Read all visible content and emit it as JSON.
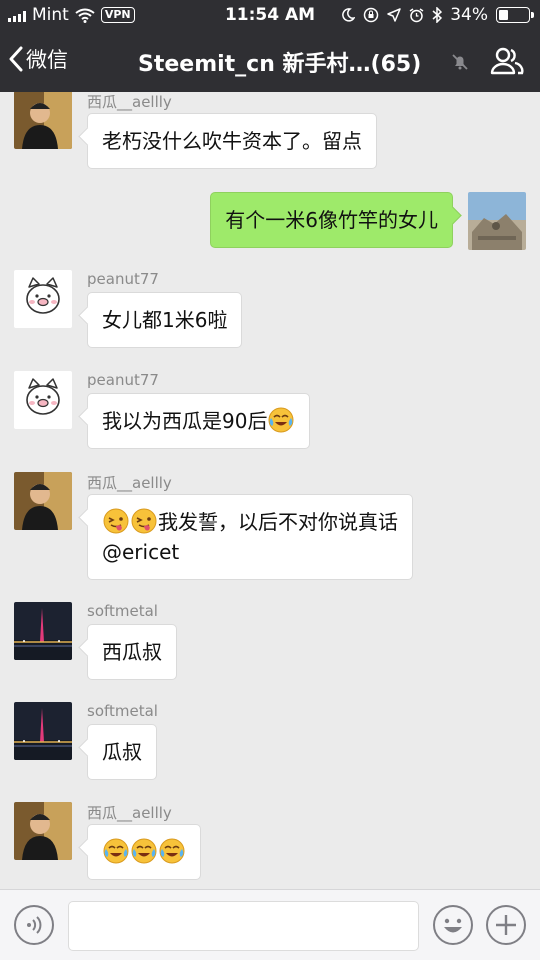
{
  "status_bar": {
    "carrier": "Mint",
    "vpn": "VPN",
    "time": "11:54 AM",
    "battery_percent": "34%",
    "battery_level": 0.34
  },
  "nav": {
    "back_label": "微信",
    "title": "Steemit_cn 新手村…(65)",
    "muted_icon": "bell-off-icon",
    "members_icon": "group-members-icon"
  },
  "messages": [
    {
      "direction": "in",
      "sender": "西瓜__aellly",
      "text": "老朽没什么吹牛资本了。留点",
      "avatar": "avatar-man-photo"
    },
    {
      "direction": "out",
      "text": "有个一米6像竹竿的女儿",
      "avatar": "avatar-landscape-photo"
    },
    {
      "direction": "in",
      "sender": "peanut77",
      "text": "女儿都1米6啦",
      "avatar": "avatar-pig-cartoon"
    },
    {
      "direction": "in",
      "sender": "peanut77",
      "text": "我以为西瓜是90后",
      "emoji": [
        "laugh-cry-emoji"
      ],
      "avatar": "avatar-pig-cartoon"
    },
    {
      "direction": "in",
      "sender": "西瓜__aellly",
      "emoji_prefix": [
        "tongue-emoji",
        "tongue-emoji"
      ],
      "text_line1": "我发誓，以后不对你说真话",
      "text_line2": "@ericet",
      "avatar": "avatar-man-photo"
    },
    {
      "direction": "in",
      "sender": "softmetal",
      "text": "西瓜叔",
      "avatar": "avatar-tower-night-photo"
    },
    {
      "direction": "in",
      "sender": "softmetal",
      "text": "瓜叔",
      "avatar": "avatar-tower-night-photo"
    },
    {
      "direction": "in",
      "sender": "西瓜__aellly",
      "emoji": [
        "laugh-cry-emoji",
        "laugh-cry-emoji",
        "laugh-cry-emoji"
      ],
      "avatar": "avatar-man-photo"
    }
  ],
  "input_bar": {
    "voice_icon": "voice-icon",
    "emoji_icon": "smiley-icon",
    "plus_icon": "plus-icon"
  },
  "colors": {
    "nav_bg": "#2f2f33",
    "chat_bg": "#ebebeb",
    "outgoing_bubble": "#9eea6a",
    "incoming_bubble": "#ffffff",
    "sender_name": "#8a8a8a"
  }
}
